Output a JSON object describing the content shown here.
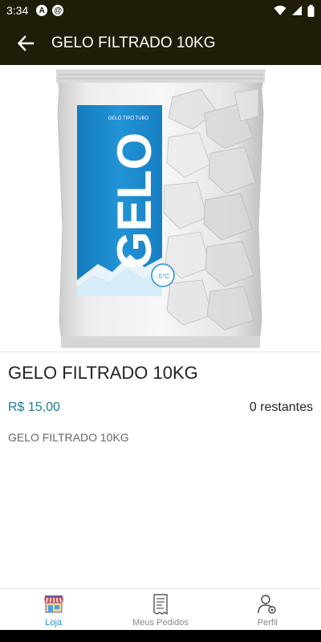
{
  "status": {
    "time": "3:34",
    "left_icons": [
      "a-circle-icon",
      "spiral-circle-icon"
    ],
    "right_icons": [
      "wifi-icon",
      "cell-signal-icon",
      "battery-icon"
    ]
  },
  "app_bar": {
    "title": "GELO FILTRADO 10KG",
    "back_icon": "arrow-left-icon"
  },
  "product_image": {
    "package_top_label": "GELO TIPO TUBO",
    "brand_text": "GELO",
    "badge_text": "-5°C",
    "accent_color": "#1c8fd1"
  },
  "product": {
    "name": "GELO FILTRADO 10KG",
    "price": "R$ 15,00",
    "stock": "0 restantes",
    "description": "GELO FILTRADO 10KG"
  },
  "bottom_nav": {
    "items": [
      {
        "label": "Loja",
        "icon": "store-icon",
        "active": true
      },
      {
        "label": "Meus Pedidos",
        "icon": "receipt-icon",
        "active": false
      },
      {
        "label": "Perfil",
        "icon": "user-settings-icon",
        "active": false
      }
    ]
  },
  "colors": {
    "app_bar": "#1f1d08",
    "price": "#1b7e96",
    "nav_active": "#1b8fd6",
    "nav_inactive": "#888888"
  }
}
